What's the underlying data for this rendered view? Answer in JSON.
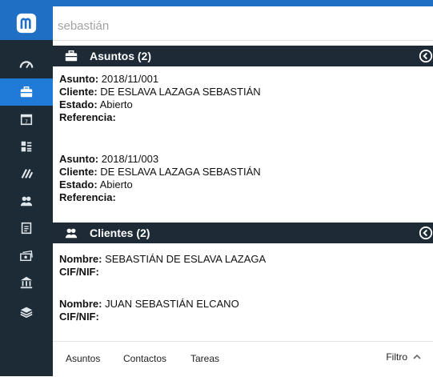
{
  "search": {
    "value": "sebastián"
  },
  "sidebar": {
    "items": [
      {
        "icon": "dashboard-icon"
      },
      {
        "icon": "briefcase-icon",
        "active": true
      },
      {
        "icon": "calendar-icon"
      },
      {
        "icon": "list-icon"
      },
      {
        "icon": "link-icon"
      },
      {
        "icon": "people-icon"
      },
      {
        "icon": "document-icon"
      },
      {
        "icon": "money-icon"
      },
      {
        "icon": "bank-icon"
      },
      {
        "icon": "layers-icon"
      }
    ]
  },
  "asuntos": {
    "title": "Asuntos (2)",
    "records": [
      {
        "asunto_label": "Asunto:",
        "asunto": "2018/11/001",
        "cliente_label": "Cliente:",
        "cliente": "DE ESLAVA LAZAGA SEBASTIÁN",
        "estado_label": "Estado:",
        "estado": "Abierto",
        "referencia_label": "Referencia:"
      },
      {
        "asunto_label": "Asunto:",
        "asunto": "2018/11/003",
        "cliente_label": "Cliente:",
        "cliente": "DE ESLAVA LAZAGA SEBASTIÁN",
        "estado_label": "Estado:",
        "estado": "Abierto",
        "referencia_label": "Referencia:"
      }
    ]
  },
  "clientes": {
    "title": "Clientes (2)",
    "records": [
      {
        "nombre_label": "Nombre:",
        "nombre": "SEBASTIÁN DE ESLAVA LAZAGA",
        "cif_label": "CIF/NIF:"
      },
      {
        "nombre_label": "Nombre:",
        "nombre": "JUAN SEBASTIÁN ELCANO",
        "cif_label": "CIF/NIF:"
      }
    ]
  },
  "footer": {
    "tabs": [
      "Asuntos",
      "Contactos",
      "Tareas"
    ],
    "filter_label": "Filtro"
  }
}
